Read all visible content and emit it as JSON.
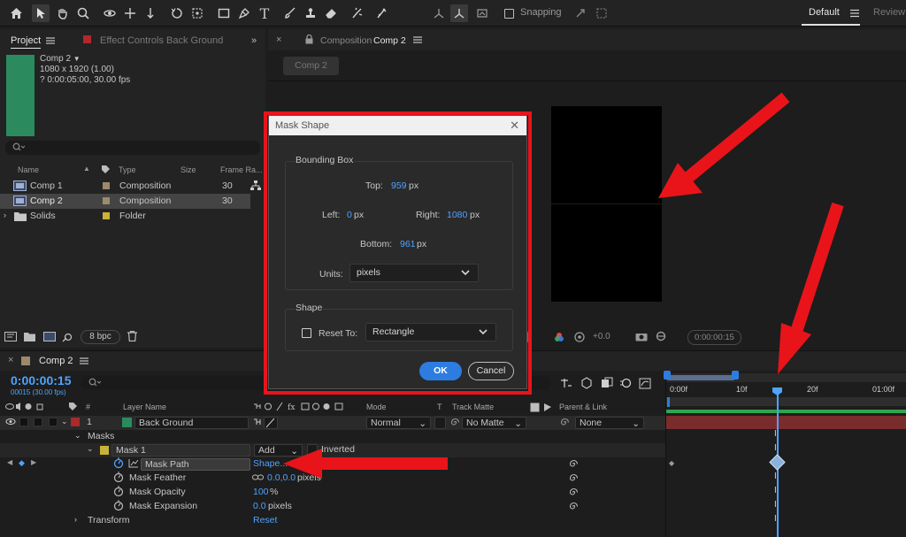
{
  "toolbar": {
    "snapping_label": "Snapping",
    "workspace_default": "Default",
    "workspace_review": "Review"
  },
  "project": {
    "tab_project": "Project",
    "tab_effect_controls": "Effect Controls Back Ground",
    "thumb_color": "#2b8b5f",
    "info_name": "Comp 2",
    "info_size": "1080 x 1920 (1.00)",
    "info_duration": "? 0:00:05:00, 30.00 fps",
    "columns": {
      "name": "Name",
      "type": "Type",
      "size": "Size",
      "frame_rate": "Frame Ra..."
    },
    "items": [
      {
        "name": "Comp 1",
        "type": "Composition",
        "frame_rate": "30",
        "swatch": "#9c8a6a"
      },
      {
        "name": "Comp 2",
        "type": "Composition",
        "frame_rate": "30",
        "swatch": "#9c8a6a"
      },
      {
        "name": "Solids",
        "type": "Folder",
        "frame_rate": "",
        "swatch": "#c9b23a"
      }
    ],
    "bpc": "8 bpc"
  },
  "composition": {
    "tab_prefix": "Composition",
    "tab_name": "Comp 2",
    "chip_label": "Comp 2",
    "exposure": "+0.0",
    "timecode": "0:00:00:15"
  },
  "timeline": {
    "tab_label": "Comp 2",
    "current_time": "0:00:00:15",
    "current_frames": "00015 (30.00 fps)",
    "columns": {
      "num": "#",
      "layer_name": "Layer Name",
      "mode": "Mode",
      "t": "T",
      "track_matte": "Track Matte",
      "parent": "Parent & Link"
    },
    "ruler": [
      "0:00f",
      "10f",
      "20f",
      "01:00f"
    ],
    "layer": {
      "number": "1",
      "name": "Back Ground",
      "mode": "Normal",
      "matte": "No Matte",
      "parent": "None"
    },
    "masks_label": "Masks",
    "mask1": {
      "name": "Mask 1",
      "mode": "Add",
      "inverted": "Inverted"
    },
    "props": [
      {
        "name": "Mask Path",
        "value": "Shape..."
      },
      {
        "name": "Mask Feather",
        "value": "0.0,0.0",
        "unit": "pixels"
      },
      {
        "name": "Mask Opacity",
        "value": "100",
        "unit": "%"
      },
      {
        "name": "Mask Expansion",
        "value": "0.0",
        "unit": "pixels"
      }
    ],
    "transform_label": "Transform",
    "transform_value": "Reset"
  },
  "dialog": {
    "title": "Mask Shape",
    "bounding_box_label": "Bounding Box",
    "top_label": "Top:",
    "top_value": "959",
    "left_label": "Left:",
    "left_value": "0",
    "right_label": "Right:",
    "right_value": "1080",
    "bottom_label": "Bottom:",
    "bottom_value": "961",
    "unit": "px",
    "units_label": "Units:",
    "units_value": "pixels",
    "shape_label": "Shape",
    "reset_to_label": "Reset To:",
    "reset_to_value": "Rectangle",
    "ok_label": "OK",
    "cancel_label": "Cancel"
  },
  "colors": {
    "accent_blue": "#4ea3ff",
    "annotation_red": "#e8141a",
    "ok_button": "#2d7de0"
  }
}
